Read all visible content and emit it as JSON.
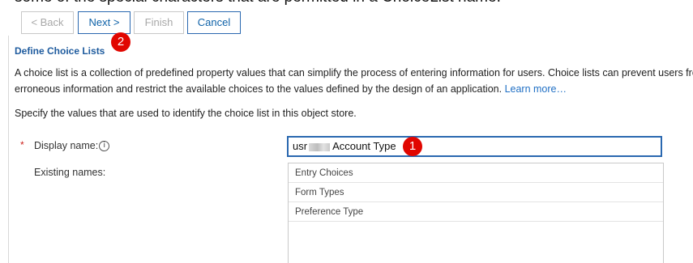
{
  "top_strip": {
    "text": "some of the special characters that are permitted in a ChoiceList name."
  },
  "wizard": {
    "back_label": "< Back",
    "next_label": "Next >",
    "finish_label": "Finish",
    "cancel_label": "Cancel"
  },
  "markers": {
    "one": "1",
    "two": "2"
  },
  "section": {
    "title": "Define Choice Lists",
    "description_line1": "A choice list is a collection of predefined property values that can simplify the process of entering information for users. Choice lists can prevent users from entering",
    "description_line2": "erroneous information and restrict the available choices to the values defined by the design of an application.",
    "learn_more": "Learn more…",
    "instruction": "Specify the values that are used to identify the choice list in this object store."
  },
  "form": {
    "required_marker": "*",
    "display_name_label": "Display name:",
    "display_name_prefix": "usr",
    "display_name_suffix": "Account Type",
    "existing_names_label": "Existing names:",
    "existing_names": [
      "Entry Choices",
      "Form Types",
      "Preference Type"
    ]
  },
  "icons": {
    "info": "i"
  },
  "colors": {
    "accent": "#2a68b0",
    "link": "#1f6fc4",
    "section_title": "#1e5b9e",
    "marker": "#e10600",
    "required": "#cc1f1a"
  }
}
